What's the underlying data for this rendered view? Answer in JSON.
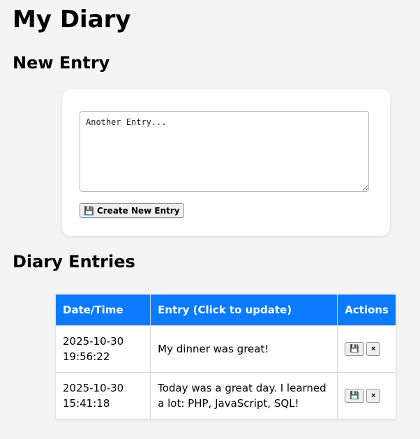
{
  "page": {
    "title": "My Diary",
    "new_entry_heading": "New Entry",
    "entries_heading": "Diary Entries"
  },
  "form": {
    "textarea_placeholder": "Another Entry...",
    "create_button_icon": "floppy-disk-icon",
    "create_button_label": "Create New Entry"
  },
  "table": {
    "headers": [
      "Date/Time",
      "Entry (Click to update)",
      "Actions"
    ],
    "rows": [
      {
        "date": "2025-10-30",
        "time": "19:56:22",
        "entry": "My dinner was great!"
      },
      {
        "date": "2025-10-30",
        "time": "15:41:18",
        "entry": "Today was a great day. I learned a lot: PHP, JavaScript, SQL!"
      }
    ],
    "save_icon": "floppy-disk-icon",
    "delete_label": "×"
  },
  "colors": {
    "header_bg": "#0a7bff",
    "page_bg": "#f4f4f4"
  }
}
